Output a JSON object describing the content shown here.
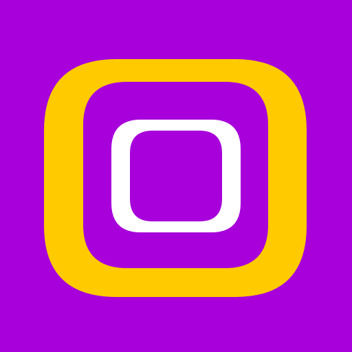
{
  "icon": {
    "name": "nested-rounded-squares-icon",
    "colors": {
      "background": "#A700DB",
      "outer_ring": "#FFCA00",
      "inner_square": "#A700DB",
      "inner_ring": "#FFFFFF"
    }
  }
}
